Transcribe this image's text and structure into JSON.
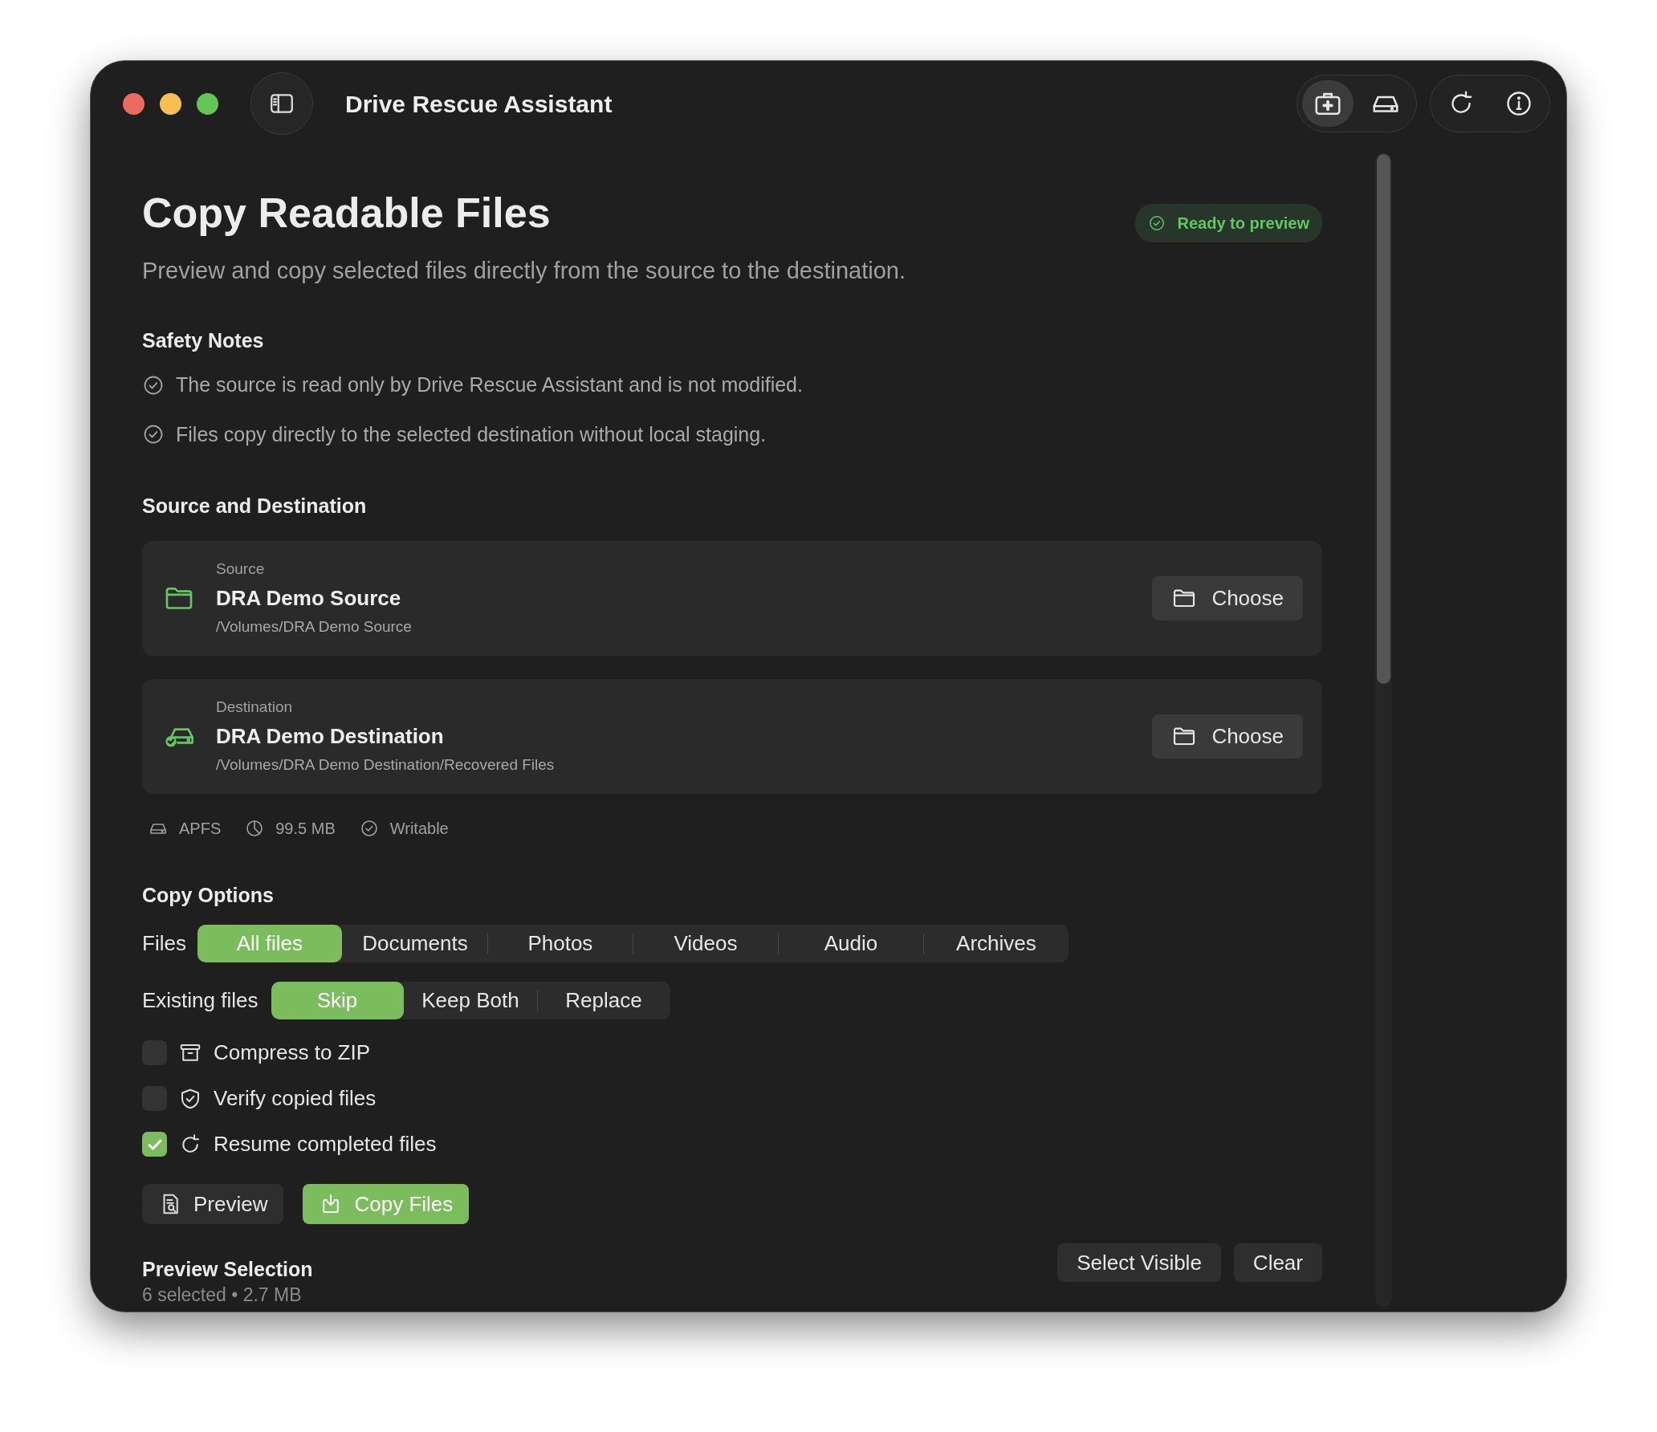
{
  "window": {
    "title": "Drive Rescue Assistant"
  },
  "toolbar": {
    "modes": [
      {
        "kind": "rescue",
        "selected": true
      },
      {
        "kind": "drive",
        "selected": false
      }
    ],
    "actions": [
      {
        "kind": "refresh"
      },
      {
        "kind": "info"
      }
    ]
  },
  "header": {
    "title": "Copy Readable Files",
    "subtitle": "Preview and copy selected files directly from the source to the destination.",
    "status": "Ready to preview"
  },
  "safety_notes": {
    "heading": "Safety Notes",
    "items": [
      "The source is read only by Drive Rescue Assistant and is not modified.",
      "Files copy directly to the selected destination without local staging."
    ]
  },
  "source_destination": {
    "heading": "Source and Destination",
    "locations": [
      {
        "kind": "source",
        "label": "Source",
        "name": "DRA Demo Source",
        "path": "/Volumes/DRA Demo Source",
        "button": "Choose"
      },
      {
        "kind": "destination",
        "label": "Destination",
        "name": "DRA Demo Destination",
        "path": "/Volumes/DRA Demo Destination/Recovered Files",
        "button": "Choose"
      }
    ],
    "volume_info": [
      {
        "kind": "format",
        "text": "APFS"
      },
      {
        "kind": "size",
        "text": "99.5 MB"
      },
      {
        "kind": "writable",
        "text": "Writable"
      }
    ]
  },
  "copy_options": {
    "heading": "Copy Options",
    "files": {
      "label": "Files",
      "options": [
        {
          "label": "All files",
          "selected": true
        },
        {
          "label": "Documents",
          "selected": false
        },
        {
          "label": "Photos",
          "selected": false
        },
        {
          "label": "Videos",
          "selected": false
        },
        {
          "label": "Audio",
          "selected": false
        },
        {
          "label": "Archives",
          "selected": false
        }
      ]
    },
    "existing_files": {
      "label": "Existing files",
      "options": [
        {
          "label": "Skip",
          "selected": true
        },
        {
          "label": "Keep Both",
          "selected": false
        },
        {
          "label": "Replace",
          "selected": false
        }
      ]
    },
    "toggles": [
      {
        "kind": "archive",
        "label": "Compress to ZIP",
        "checked": false
      },
      {
        "kind": "verify",
        "label": "Verify copied files",
        "checked": false
      },
      {
        "kind": "resume",
        "label": "Resume completed files",
        "checked": true
      }
    ]
  },
  "actions": [
    {
      "kind": "preview",
      "label": "Preview"
    },
    {
      "kind": "copy",
      "label": "Copy Files"
    }
  ],
  "preview_selection": {
    "heading": "Preview Selection",
    "summary": "6 selected • 2.7 MB",
    "buttons": [
      "Select Visible",
      "Clear"
    ]
  }
}
